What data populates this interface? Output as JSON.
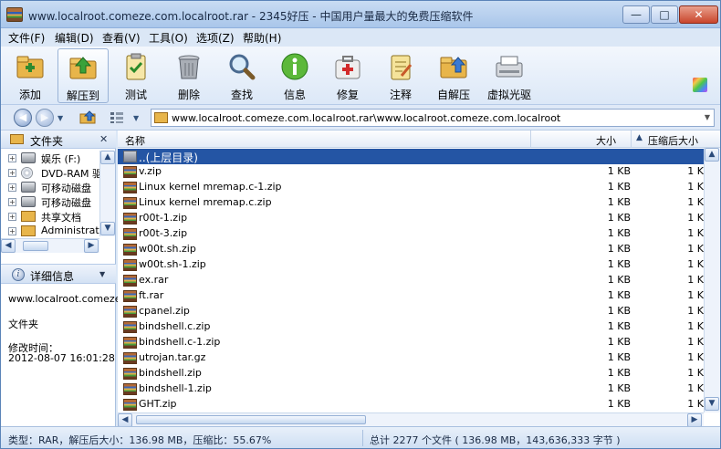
{
  "title": "www.localroot.comeze.com.localroot.rar - 2345好压 - 中国用户量最大的免费压缩软件",
  "window_buttons": {
    "minimize": "—",
    "maximize": "□",
    "close": "✕"
  },
  "menu": [
    "文件(F)",
    "编辑(D)",
    "查看(V)",
    "工具(O)",
    "选项(Z)",
    "帮助(H)"
  ],
  "toolbar": [
    {
      "label": "添加",
      "icon": "add-archive-icon"
    },
    {
      "label": "解压到",
      "icon": "extract-to-icon"
    },
    {
      "label": "测试",
      "icon": "test-clipboard-icon"
    },
    {
      "label": "删除",
      "icon": "trash-icon"
    },
    {
      "label": "查找",
      "icon": "magnifier-icon"
    },
    {
      "label": "信息",
      "icon": "info-icon"
    },
    {
      "label": "修复",
      "icon": "repair-kit-icon"
    },
    {
      "label": "注释",
      "icon": "notepad-icon"
    },
    {
      "label": "自解压",
      "icon": "self-extract-icon"
    },
    {
      "label": "虚拟光驱",
      "icon": "virtual-drive-icon"
    }
  ],
  "address": {
    "path": "www.localroot.comeze.com.localroot.rar\\www.localroot.comeze.com.localroot"
  },
  "left_pane": {
    "folder_header": "文件夹",
    "tree": [
      "娱乐 (F:)",
      "DVD-RAM 驱",
      "可移动磁盘",
      "可移动磁盘",
      "共享文档",
      "Administrator"
    ],
    "detail_header": "详细信息",
    "detail_name": "www.localroot.comeze",
    "detail_type": "文件夹",
    "modified_label": "修改时间：",
    "modified_value": "2012-08-07 16:01:28"
  },
  "list": {
    "columns": {
      "name": "名称",
      "size": "大小",
      "compressed": "压缩后大小"
    },
    "up_dir": "..(上层目录)",
    "rows": [
      {
        "name": "v.zip",
        "size": "1 KB",
        "comp": "1 K"
      },
      {
        "name": "Linux kernel mremap.c-1.zip",
        "size": "1 KB",
        "comp": "1 K"
      },
      {
        "name": "Linux kernel mremap.c.zip",
        "size": "1 KB",
        "comp": "1 K"
      },
      {
        "name": "r00t-1.zip",
        "size": "1 KB",
        "comp": "1 K"
      },
      {
        "name": "r00t-3.zip",
        "size": "1 KB",
        "comp": "1 K"
      },
      {
        "name": "w00t.sh.zip",
        "size": "1 KB",
        "comp": "1 K"
      },
      {
        "name": "w00t.sh-1.zip",
        "size": "1 KB",
        "comp": "1 K"
      },
      {
        "name": "ex.rar",
        "size": "1 KB",
        "comp": "1 K"
      },
      {
        "name": "ft.rar",
        "size": "1 KB",
        "comp": "1 K"
      },
      {
        "name": "cpanel.zip",
        "size": "1 KB",
        "comp": "1 K"
      },
      {
        "name": "bindshell.c.zip",
        "size": "1 KB",
        "comp": "1 K"
      },
      {
        "name": "bindshell.c-1.zip",
        "size": "1 KB",
        "comp": "1 K"
      },
      {
        "name": "utrojan.tar.gz",
        "size": "1 KB",
        "comp": "1 K"
      },
      {
        "name": "bindshell.zip",
        "size": "1 KB",
        "comp": "1 K"
      },
      {
        "name": "bindshell-1.zip",
        "size": "1 KB",
        "comp": "1 K"
      },
      {
        "name": "GHT.zip",
        "size": "1 KB",
        "comp": "1 K"
      }
    ]
  },
  "status": {
    "left": "类型：RAR，解压后大小：136.98 MB，压缩比：55.67%",
    "right": "总计 2277 个文件 ( 136.98 MB，143,636,333 字节 )"
  },
  "colors": {
    "selection": "#2455a4",
    "chrome": "#dbe7f6",
    "close_button": "#c9452c"
  }
}
